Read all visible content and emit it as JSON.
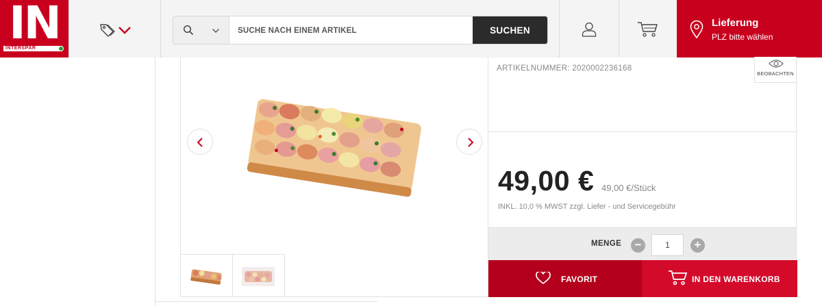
{
  "header": {
    "logo": {
      "mark": "IN",
      "wordmark": "INTERSPAR"
    },
    "offers_icon": "tag-icon",
    "search": {
      "placeholder": "SUCHE NACH EINEM ARTIKEL",
      "button_label": "SUCHEN"
    },
    "account_icon": "user-icon",
    "cart_icon": "cart-icon",
    "delivery": {
      "title": "Lieferung",
      "subtitle": "PLZ bitte wählen",
      "icon": "location-pin-icon"
    }
  },
  "product": {
    "article_number": "ARTIKELNUMMER: 2020002236168",
    "watch_label": "BEOBACHTEN",
    "price": "49,00 €",
    "unit_price": "49,00 €/Stück",
    "tax_note": "INKL. 10,0 % MWST zzgl. Liefer - und Servicegebühr",
    "quantity": {
      "label": "MENGE",
      "value": "1",
      "minus": "−",
      "plus": "+"
    },
    "favorite_label": "FAVORIT",
    "add_to_cart_label": "IN DEN WARENKORB",
    "gallery": {
      "thumbnails": 2
    }
  },
  "colors": {
    "brand_red": "#c8001e",
    "button_red": "#d40a2a",
    "dark": "#2b2b2b"
  }
}
